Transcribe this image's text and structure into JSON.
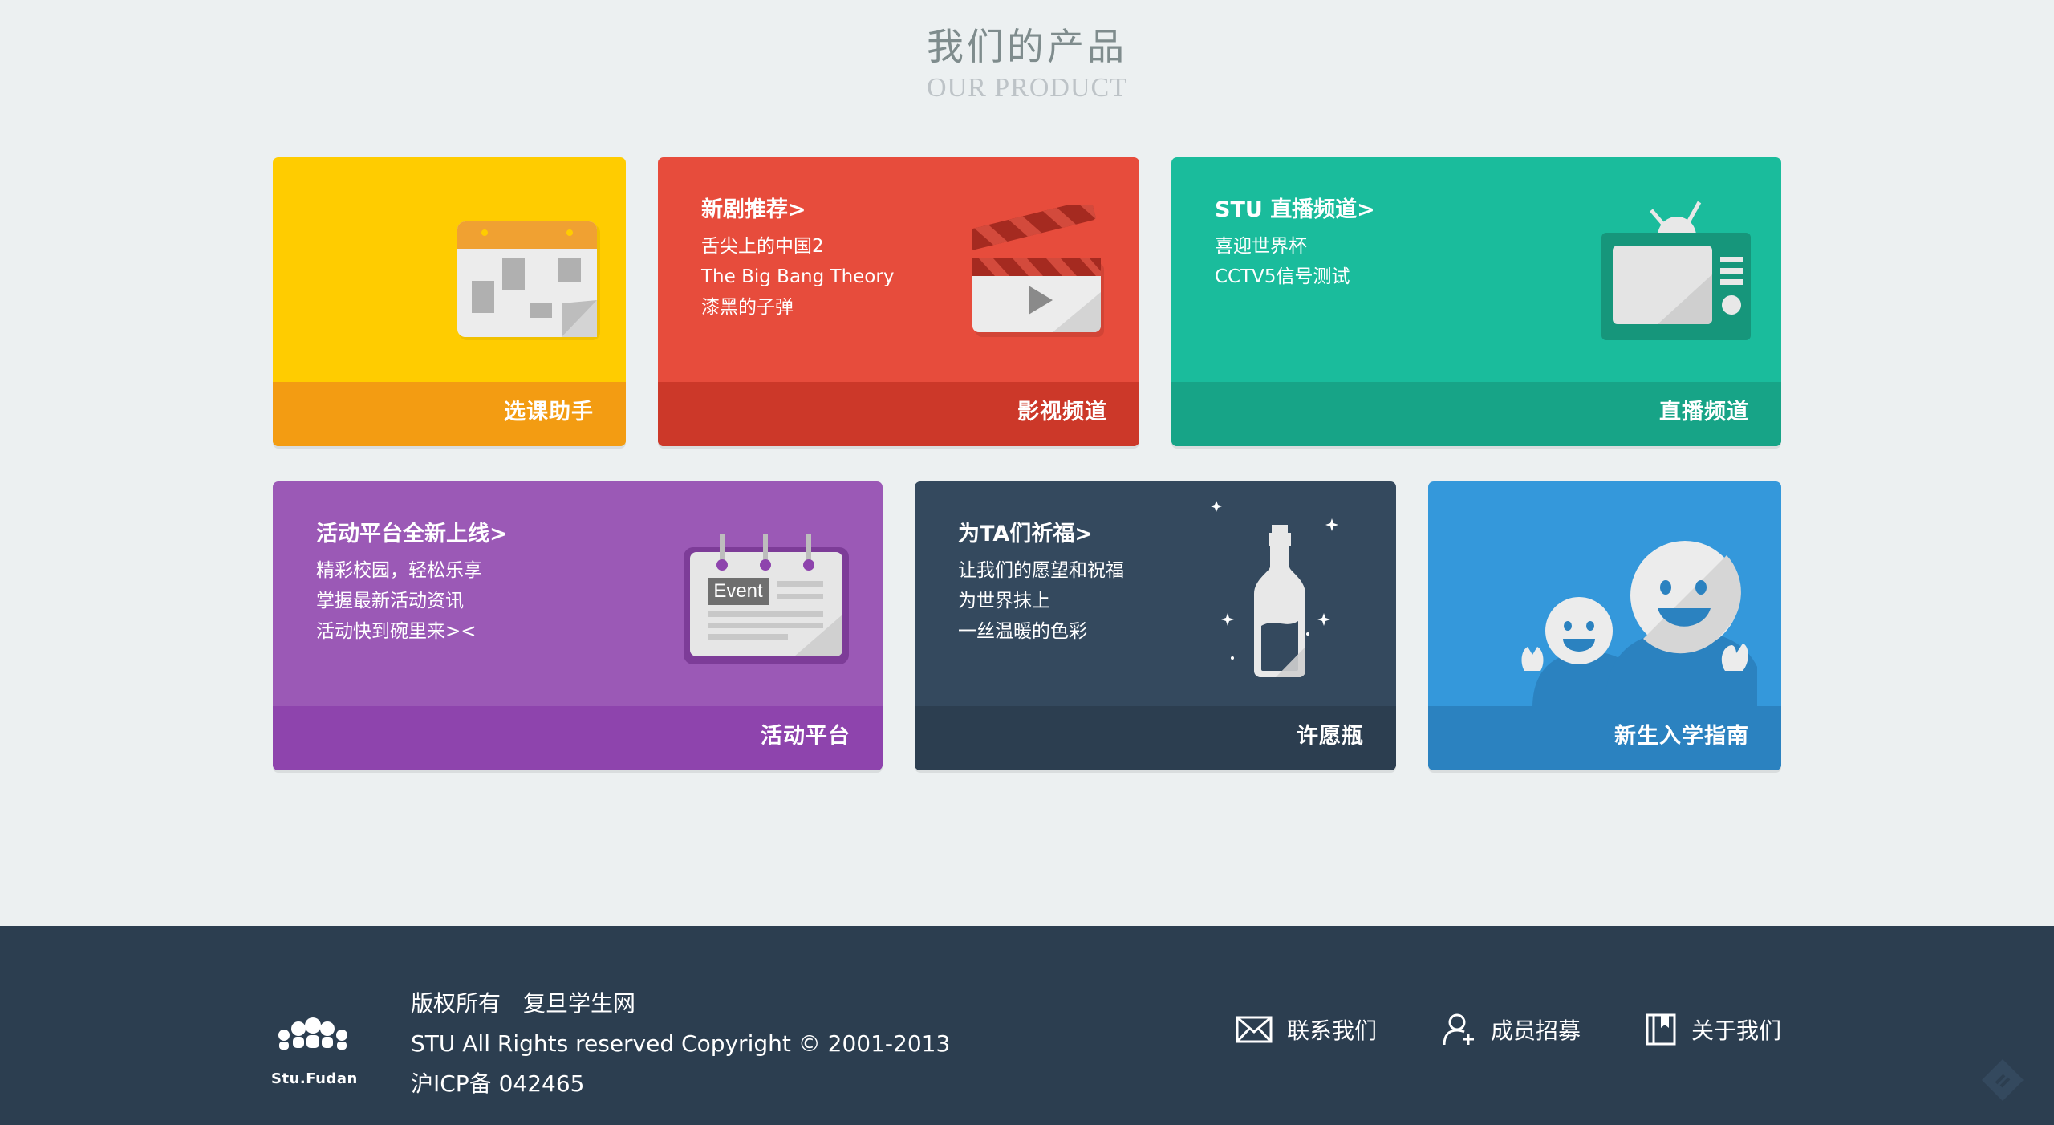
{
  "section": {
    "title_zh": "我们的产品",
    "title_en": "OUR PRODUCT"
  },
  "cards": {
    "course": {
      "footer": "选课助手",
      "color": "#ffcc00",
      "footer_color": "#f39c12",
      "icon": "calendar-icon"
    },
    "video": {
      "title": "新剧推荐>",
      "lines": [
        "舌尖上的中国2",
        "The Big Bang Theory",
        "漆黑的子弹"
      ],
      "footer": "影视频道",
      "color": "#e74c3c",
      "footer_color": "#cc3829",
      "icon": "clapperboard-icon"
    },
    "live": {
      "title": "STU 直播频道>",
      "lines": [
        "喜迎世界杯",
        "CCTV5信号测试"
      ],
      "footer": "直播频道",
      "color": "#1abc9c",
      "footer_color": "#17a487",
      "icon": "tv-icon"
    },
    "activity": {
      "title": "活动平台全新上线>",
      "lines": [
        "精彩校园，轻松乐享",
        "掌握最新活动资讯",
        "活动快到碗里来><"
      ],
      "footer": "活动平台",
      "badge": "Event",
      "color": "#9b59b6",
      "footer_color": "#8e44ad",
      "icon": "event-calendar-icon"
    },
    "wish": {
      "title": "为TA们祈福>",
      "lines": [
        "让我们的愿望和祝福",
        "为世界抹上",
        "一丝温暖的色彩"
      ],
      "footer": "许愿瓶",
      "color": "#34495e",
      "footer_color": "#2c3e50",
      "icon": "bottle-icon"
    },
    "freshman": {
      "footer": "新生入学指南",
      "color": "#3498db",
      "footer_color": "#2b82c0",
      "icon": "smiley-people-icon"
    }
  },
  "footer": {
    "logo_text": "Stu.Fudan",
    "copyright_lines": [
      "版权所有　复旦学生网",
      "STU All Rights reserved Copyright © 2001-2013",
      "沪ICP备 042465"
    ],
    "links": [
      {
        "label": "联系我们",
        "icon": "mail-icon"
      },
      {
        "label": "成员招募",
        "icon": "add-user-icon"
      },
      {
        "label": "关于我们",
        "icon": "book-icon"
      }
    ]
  }
}
